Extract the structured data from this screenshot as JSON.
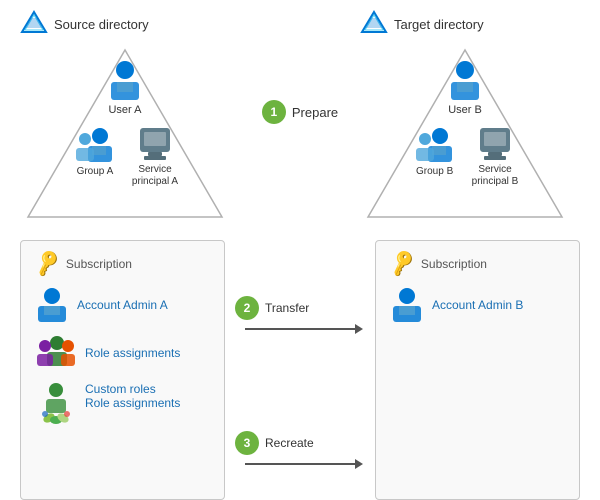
{
  "top": {
    "source": {
      "label": "Source directory",
      "user": "User A",
      "group": "Group A",
      "service": "Service\nprincipal A"
    },
    "target": {
      "label": "Target directory",
      "user": "User B",
      "group": "Group B",
      "service": "Service\nprincipal B"
    },
    "step1": {
      "number": "1",
      "label": "Prepare"
    }
  },
  "bottom": {
    "source_sub": {
      "label": "Subscription",
      "account_admin": "Account Admin A",
      "role_assignments": "Role assignments",
      "custom_roles": "Custom roles",
      "role_assignments2": "Role assignments"
    },
    "target_sub": {
      "label": "Subscription",
      "account_admin": "Account Admin B"
    },
    "step2": {
      "number": "2",
      "label": "Transfer"
    },
    "step3": {
      "number": "3",
      "label": "Recreate"
    }
  }
}
